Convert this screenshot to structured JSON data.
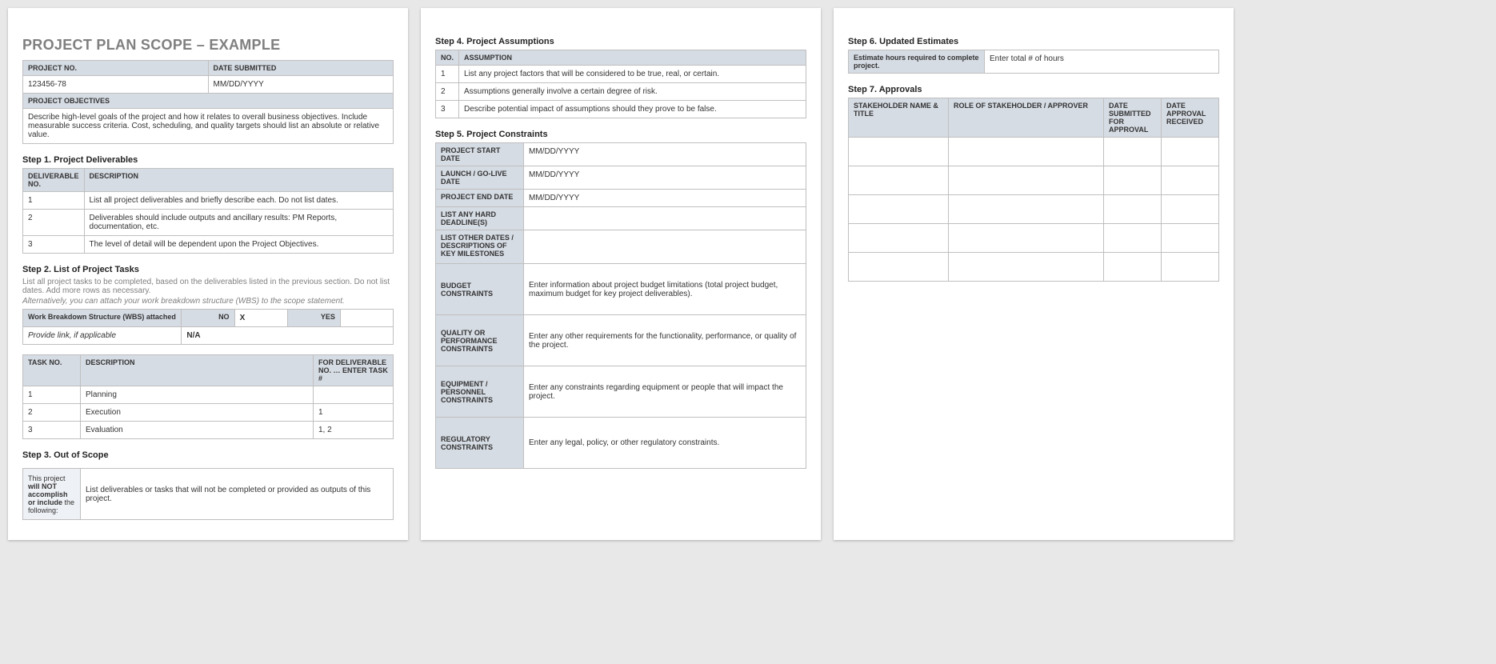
{
  "title": "PROJECT PLAN SCOPE – EXAMPLE",
  "meta": {
    "project_no_label": "PROJECT NO.",
    "date_submitted_label": "DATE SUBMITTED",
    "project_no": "123456-78",
    "date_submitted": "MM/DD/YYYY",
    "objectives_label": "PROJECT OBJECTIVES",
    "objectives_text": "Describe high-level goals of the project and how it relates to overall business objectives.  Include measurable success criteria.  Cost, scheduling, and quality targets should list an absolute or relative value."
  },
  "step1": {
    "heading": "Step 1. Project Deliverables",
    "col1": "DELIVERABLE NO.",
    "col2": "DESCRIPTION",
    "rows": [
      {
        "no": "1",
        "desc": "List all project deliverables and briefly describe each. Do not list dates."
      },
      {
        "no": "2",
        "desc": "Deliverables should include outputs and ancillary results: PM Reports, documentation, etc."
      },
      {
        "no": "3",
        "desc": "The level of detail will be dependent upon the Project Objectives."
      }
    ]
  },
  "step2": {
    "heading": "Step 2. List of Project Tasks",
    "note1": "List all project tasks to be completed, based on the deliverables listed in the previous section. Do not list dates. Add more rows as necessary.",
    "note2": "Alternatively, you can attach your work breakdown structure (WBS) to the scope statement.",
    "wbs_label": "Work Breakdown Structure (WBS) attached",
    "no_label": "NO",
    "no_value": "X",
    "yes_label": "YES",
    "yes_value": "",
    "link_label": "Provide link, if applicable",
    "link_value": "N/A",
    "task_col1": "TASK NO.",
    "task_col2": "DESCRIPTION",
    "task_col3": "FOR DELIVERABLE NO. … ENTER TASK #",
    "tasks": [
      {
        "no": "1",
        "desc": "Planning",
        "for": ""
      },
      {
        "no": "2",
        "desc": "Execution",
        "for": "1"
      },
      {
        "no": "3",
        "desc": "Evaluation",
        "for": "1, 2"
      }
    ]
  },
  "step3": {
    "heading": "Step 3. Out of Scope",
    "label_html": "This project <b>will NOT accomplish or include</b> the following:",
    "label_p1": "This project ",
    "label_b": "will NOT accomplish or include",
    "label_p2": " the following:",
    "text": "List deliverables or tasks that will not be completed or provided as outputs of this project."
  },
  "step4": {
    "heading": "Step 4. Project Assumptions",
    "col1": "NO.",
    "col2": "ASSUMPTION",
    "rows": [
      {
        "no": "1",
        "desc": "List any project factors that will be considered to be true, real, or certain."
      },
      {
        "no": "2",
        "desc": "Assumptions generally involve a certain degree of risk."
      },
      {
        "no": "3",
        "desc": "Describe potential impact of assumptions should they prove to be false."
      }
    ]
  },
  "step5": {
    "heading": "Step 5. Project Constraints",
    "start_label": "PROJECT START DATE",
    "start_val": "MM/DD/YYYY",
    "live_label": "LAUNCH / GO-LIVE DATE",
    "live_val": "MM/DD/YYYY",
    "end_label": "PROJECT END DATE",
    "end_val": "MM/DD/YYYY",
    "hard_label": "LIST ANY HARD DEADLINE(S)",
    "hard_val": "",
    "other_label": "LIST OTHER DATES / DESCRIPTIONS OF KEY MILESTONES",
    "other_val": "",
    "budget_label": "BUDGET CONSTRAINTS",
    "budget_val": "Enter information about project budget limitations (total project budget, maximum budget for key project deliverables).",
    "quality_label": "QUALITY OR PERFORMANCE CONSTRAINTS",
    "quality_val": "Enter any other requirements for the functionality, performance, or quality of the project.",
    "equip_label": "EQUIPMENT / PERSONNEL CONSTRAINTS",
    "equip_val": "Enter any constraints regarding equipment or people that will impact the project.",
    "reg_label": "REGULATORY CONSTRAINTS",
    "reg_val": "Enter any legal, policy, or other regulatory constraints."
  },
  "step6": {
    "heading": "Step 6. Updated Estimates",
    "label": "Estimate hours required to complete project.",
    "value": "Enter total # of hours"
  },
  "step7": {
    "heading": "Step 7. Approvals",
    "col1": "STAKEHOLDER NAME & TITLE",
    "col2": "ROLE OF STAKEHOLDER / APPROVER",
    "col3": "DATE SUBMITTED FOR APPROVAL",
    "col4": "DATE APPROVAL RECEIVED"
  }
}
